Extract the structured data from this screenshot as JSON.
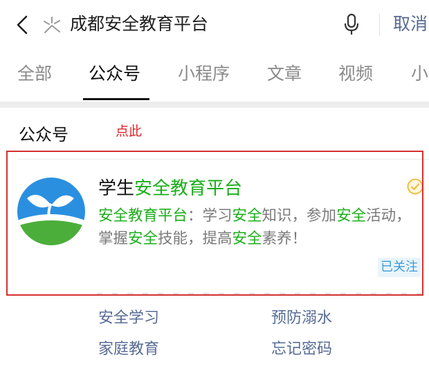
{
  "search": {
    "query": "成都安全教育平台",
    "cancel_label": "取消"
  },
  "tabs": [
    {
      "label": "全部",
      "active": false
    },
    {
      "label": "公众号",
      "active": true
    },
    {
      "label": "小程序",
      "active": false
    },
    {
      "label": "文章",
      "active": false
    },
    {
      "label": "视频",
      "active": false
    },
    {
      "label": "小",
      "active": false
    }
  ],
  "section": {
    "title": "公众号",
    "annotation": "点此"
  },
  "account": {
    "name_prefix": "学生",
    "name_highlight": "安全教育平台",
    "desc_parts": [
      {
        "text": "安全教育平台",
        "hl": true
      },
      {
        "text": "：学习",
        "hl": false
      },
      {
        "text": "安全",
        "hl": true
      },
      {
        "text": "知识，参加",
        "hl": false
      },
      {
        "text": "安全",
        "hl": true
      },
      {
        "text": "活动，掌握",
        "hl": false
      },
      {
        "text": "安全",
        "hl": true
      },
      {
        "text": "技能，提高",
        "hl": false
      },
      {
        "text": "安全",
        "hl": true
      },
      {
        "text": "素养！",
        "hl": false
      }
    ],
    "followed_label": "已关注"
  },
  "menus": [
    {
      "label": "安全学习"
    },
    {
      "label": "预防溺水"
    },
    {
      "label": "家庭教育"
    },
    {
      "label": "忘记密码"
    }
  ],
  "colors": {
    "highlight": "#1aad19",
    "link": "#576b95",
    "annotation": "#d9262a"
  }
}
